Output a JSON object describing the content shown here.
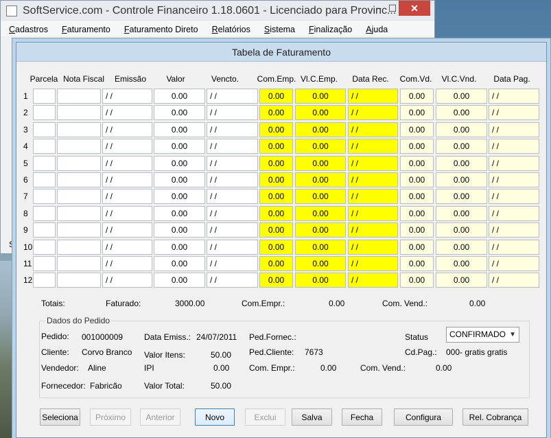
{
  "back_window": {
    "title": "SoftService.com - Controle Financeiro 1.18.0601 - Licenciado para Provinc...",
    "controls": {
      "minimize": "−",
      "maximize": "☐",
      "close": "✕"
    },
    "menu": [
      "Cadastros",
      "Faturamento",
      "Faturamento Direto",
      "Relatórios",
      "Sistema",
      "Finalização",
      "Ajuda"
    ],
    "status_letter": "S"
  },
  "dialog": {
    "title": "Tabela de Faturamento",
    "columns": [
      "Parcela",
      "Nota Fiscal",
      "Emissão",
      "Valor",
      "Vencto.",
      "Com.Emp.",
      "Vl.C.Emp.",
      "Data Rec.",
      "Com.Vd.",
      "Vl.C.Vnd.",
      "Data Pag."
    ],
    "rows": [
      {
        "n": "1",
        "nota": "",
        "emissao": "/ /",
        "valor": "0.00",
        "vencto": "/ /",
        "com_emp": "0.00",
        "vl_c_emp": "0.00",
        "data_rec": "/ /",
        "com_vd": "0.00",
        "vl_c_vnd": "0.00",
        "data_pag": "/ /"
      },
      {
        "n": "2",
        "nota": "",
        "emissao": "/ /",
        "valor": "0.00",
        "vencto": "/ /",
        "com_emp": "0.00",
        "vl_c_emp": "0.00",
        "data_rec": "/ /",
        "com_vd": "0.00",
        "vl_c_vnd": "0.00",
        "data_pag": "/ /"
      },
      {
        "n": "3",
        "nota": "",
        "emissao": "/ /",
        "valor": "0.00",
        "vencto": "/ /",
        "com_emp": "0.00",
        "vl_c_emp": "0.00",
        "data_rec": "/ /",
        "com_vd": "0.00",
        "vl_c_vnd": "0.00",
        "data_pag": "/ /"
      },
      {
        "n": "4",
        "nota": "",
        "emissao": "/ /",
        "valor": "0.00",
        "vencto": "/ /",
        "com_emp": "0.00",
        "vl_c_emp": "0.00",
        "data_rec": "/ /",
        "com_vd": "0.00",
        "vl_c_vnd": "0.00",
        "data_pag": "/ /"
      },
      {
        "n": "5",
        "nota": "",
        "emissao": "/ /",
        "valor": "0.00",
        "vencto": "/ /",
        "com_emp": "0.00",
        "vl_c_emp": "0.00",
        "data_rec": "/ /",
        "com_vd": "0.00",
        "vl_c_vnd": "0.00",
        "data_pag": "/ /"
      },
      {
        "n": "6",
        "nota": "",
        "emissao": "/ /",
        "valor": "0.00",
        "vencto": "/ /",
        "com_emp": "0.00",
        "vl_c_emp": "0.00",
        "data_rec": "/ /",
        "com_vd": "0.00",
        "vl_c_vnd": "0.00",
        "data_pag": "/ /"
      },
      {
        "n": "7",
        "nota": "",
        "emissao": "/ /",
        "valor": "0.00",
        "vencto": "/ /",
        "com_emp": "0.00",
        "vl_c_emp": "0.00",
        "data_rec": "/ /",
        "com_vd": "0.00",
        "vl_c_vnd": "0.00",
        "data_pag": "/ /"
      },
      {
        "n": "8",
        "nota": "",
        "emissao": "/ /",
        "valor": "0.00",
        "vencto": "/ /",
        "com_emp": "0.00",
        "vl_c_emp": "0.00",
        "data_rec": "/ /",
        "com_vd": "0.00",
        "vl_c_vnd": "0.00",
        "data_pag": "/ /"
      },
      {
        "n": "9",
        "nota": "",
        "emissao": "/ /",
        "valor": "0.00",
        "vencto": "/ /",
        "com_emp": "0.00",
        "vl_c_emp": "0.00",
        "data_rec": "/ /",
        "com_vd": "0.00",
        "vl_c_vnd": "0.00",
        "data_pag": "/ /"
      },
      {
        "n": "10",
        "nota": "",
        "emissao": "/ /",
        "valor": "0.00",
        "vencto": "/ /",
        "com_emp": "0.00",
        "vl_c_emp": "0.00",
        "data_rec": "/ /",
        "com_vd": "0.00",
        "vl_c_vnd": "0.00",
        "data_pag": "/ /"
      },
      {
        "n": "11",
        "nota": "",
        "emissao": "/ /",
        "valor": "0.00",
        "vencto": "/ /",
        "com_emp": "0.00",
        "vl_c_emp": "0.00",
        "data_rec": "/ /",
        "com_vd": "0.00",
        "vl_c_vnd": "0.00",
        "data_pag": "/ /"
      },
      {
        "n": "12",
        "nota": "",
        "emissao": "/ /",
        "valor": "0.00",
        "vencto": "/ /",
        "com_emp": "0.00",
        "vl_c_emp": "0.00",
        "data_rec": "/ /",
        "com_vd": "0.00",
        "vl_c_vnd": "0.00",
        "data_pag": "/ /"
      }
    ],
    "totals": {
      "label": "Totais:",
      "faturado_label": "Faturado:",
      "faturado_value": "3000.00",
      "com_empr_label": "Com.Empr.:",
      "com_empr_value": "0.00",
      "com_vend_label": "Com. Vend.:",
      "com_vend_value": "0.00"
    },
    "pedido": {
      "group_title": "Dados do Pedido",
      "pedido_label": "Pedido:",
      "pedido_value": "001000009",
      "data_emiss_label": "Data Emiss.:",
      "data_emiss_value": "24/07/2011",
      "ped_fornec_label": "Ped.Fornec.:",
      "ped_fornec_value": "",
      "status_label": "Status",
      "status_value": "CONFIRMADO",
      "cliente_label": "Cliente:",
      "cliente_value": "Corvo Branco",
      "valor_itens_label": "Valor Itens:",
      "valor_itens_value": "50.00",
      "ped_cliente_label": "Ped.Cliente:",
      "ped_cliente_value": "7673",
      "cd_pag_label": "Cd.Pag.:",
      "cd_pag_value": "000- gratis gratis",
      "vendedor_label": "Vendedor:",
      "vendedor_value": "Aline",
      "ipi_label": "IPI",
      "ipi_value": "0.00",
      "com_empr_label": "Com. Empr.:",
      "com_empr_value": "0.00",
      "com_vend_label": "Com. Vend.:",
      "com_vend_value": "0.00",
      "fornecedor_label": "Fornecedor:",
      "fornecedor_value": "Fabricão",
      "valor_total_label": "Valor Total:",
      "valor_total_value": "50.00"
    },
    "buttons": {
      "seleciona": "Seleciona",
      "proximo": "Próximo",
      "anterior": "Anterior",
      "novo": "Novo",
      "exclui": "Exclui",
      "salva": "Salva",
      "fecha": "Fecha",
      "configura": "Configura",
      "rel_cobranca": "Rel. Cobrança"
    },
    "colors": {
      "commission_field": "#ffff00",
      "payment_field": "#ffffe0",
      "title_bar": "#c9dcee"
    }
  }
}
